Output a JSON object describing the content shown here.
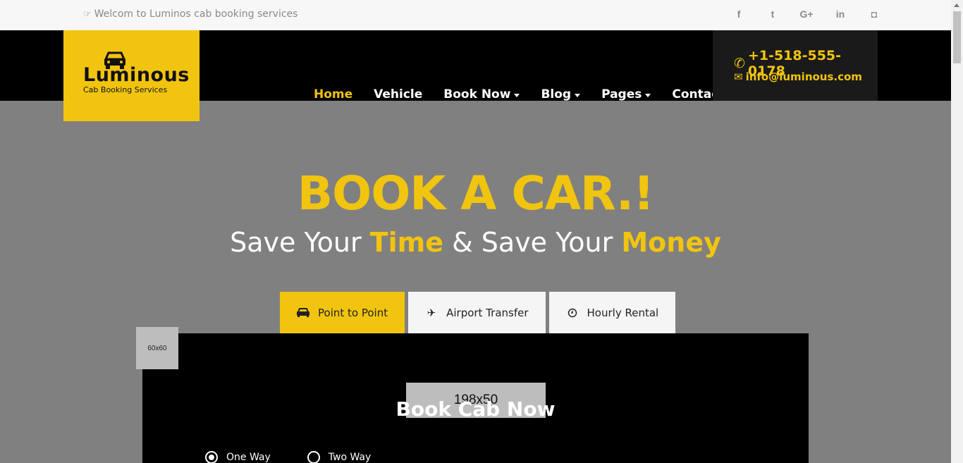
{
  "topbar": {
    "welcome_text": "Welcom to Luminos cab booking services",
    "social": [
      {
        "icon": "facebook-icon",
        "glyph": "f"
      },
      {
        "icon": "twitter-icon",
        "glyph": "t"
      },
      {
        "icon": "google-plus-icon",
        "glyph": "G+"
      },
      {
        "icon": "linkedin-icon",
        "glyph": "in"
      },
      {
        "icon": "instagram-icon",
        "glyph": "◘"
      }
    ]
  },
  "logo": {
    "name": "Luminous",
    "tagline": "Cab Booking Services"
  },
  "nav": {
    "home": "Home",
    "vehicle": "Vehicle",
    "book_now": "Book Now",
    "blog": "Blog",
    "pages": "Pages",
    "contact": "Contact"
  },
  "contact": {
    "phone": "+1-518-555-0178",
    "email": "info@luminous.com"
  },
  "hero": {
    "title": "BOOK A CAR.!",
    "sub_1": "Save Your ",
    "sub_hl_1": "Time",
    "sub_2": " & Save Your ",
    "sub_hl_2": "Money"
  },
  "tabs": {
    "point": "Point to Point",
    "airport": "Airport Transfer",
    "hourly": "Hourly Rental"
  },
  "placeholders": {
    "small": "60x60",
    "banner": "198x50"
  },
  "form": {
    "heading": "Book Cab Now",
    "one_way": "One Way",
    "two_way": "Two Way"
  },
  "colors": {
    "accent": "#f1c40f",
    "header_bg": "#000000",
    "hero_bg": "#808080"
  }
}
